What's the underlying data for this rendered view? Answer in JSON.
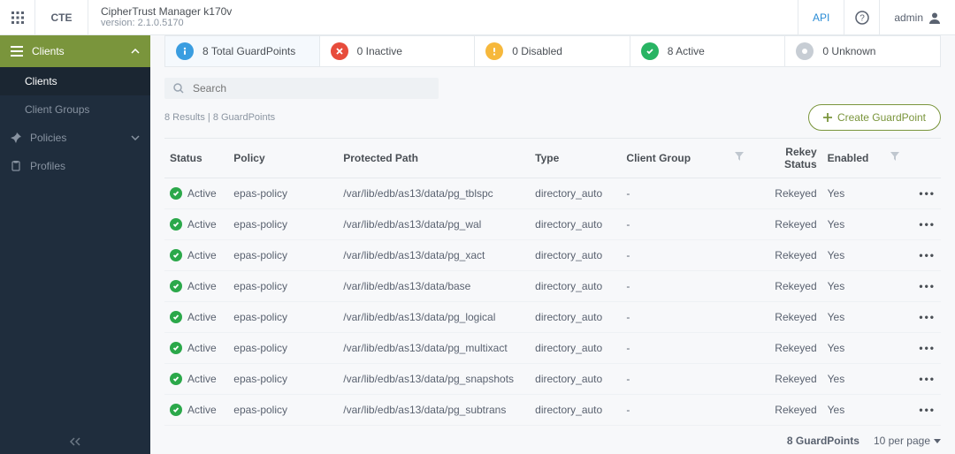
{
  "header": {
    "cte_label": "CTE",
    "product_name": "CipherTrust Manager k170v",
    "version_label": "version: 2.1.0.5170",
    "api_label": "API",
    "user_label": "admin"
  },
  "sidebar": {
    "section_label": "Clients",
    "items": [
      {
        "label": "Clients"
      },
      {
        "label": "Client Groups"
      }
    ],
    "top_items": [
      {
        "label": "Policies"
      },
      {
        "label": "Profiles"
      }
    ]
  },
  "summary": {
    "total": {
      "count": "8",
      "label": "Total GuardPoints"
    },
    "inactive": {
      "count": "0",
      "label": "Inactive"
    },
    "disabled": {
      "count": "0",
      "label": "Disabled"
    },
    "active": {
      "count": "8",
      "label": "Active"
    },
    "unknown": {
      "count": "0",
      "label": "Unknown"
    }
  },
  "search": {
    "placeholder": "Search"
  },
  "results_text": "8 Results | 8 GuardPoints",
  "create_button": "Create GuardPoint",
  "columns": {
    "status": "Status",
    "policy": "Policy",
    "path": "Protected Path",
    "type": "Type",
    "group": "Client Group",
    "rekey": "Rekey Status",
    "enabled": "Enabled"
  },
  "rows": [
    {
      "status": "Active",
      "policy": "epas-policy",
      "path": "/var/lib/edb/as13/data/pg_tblspc",
      "type": "directory_auto",
      "group": "-",
      "rekey": "Rekeyed",
      "enabled": "Yes"
    },
    {
      "status": "Active",
      "policy": "epas-policy",
      "path": "/var/lib/edb/as13/data/pg_wal",
      "type": "directory_auto",
      "group": "-",
      "rekey": "Rekeyed",
      "enabled": "Yes"
    },
    {
      "status": "Active",
      "policy": "epas-policy",
      "path": "/var/lib/edb/as13/data/pg_xact",
      "type": "directory_auto",
      "group": "-",
      "rekey": "Rekeyed",
      "enabled": "Yes"
    },
    {
      "status": "Active",
      "policy": "epas-policy",
      "path": "/var/lib/edb/as13/data/base",
      "type": "directory_auto",
      "group": "-",
      "rekey": "Rekeyed",
      "enabled": "Yes"
    },
    {
      "status": "Active",
      "policy": "epas-policy",
      "path": "/var/lib/edb/as13/data/pg_logical",
      "type": "directory_auto",
      "group": "-",
      "rekey": "Rekeyed",
      "enabled": "Yes"
    },
    {
      "status": "Active",
      "policy": "epas-policy",
      "path": "/var/lib/edb/as13/data/pg_multixact",
      "type": "directory_auto",
      "group": "-",
      "rekey": "Rekeyed",
      "enabled": "Yes"
    },
    {
      "status": "Active",
      "policy": "epas-policy",
      "path": "/var/lib/edb/as13/data/pg_snapshots",
      "type": "directory_auto",
      "group": "-",
      "rekey": "Rekeyed",
      "enabled": "Yes"
    },
    {
      "status": "Active",
      "policy": "epas-policy",
      "path": "/var/lib/edb/as13/data/pg_subtrans",
      "type": "directory_auto",
      "group": "-",
      "rekey": "Rekeyed",
      "enabled": "Yes"
    }
  ],
  "pager": {
    "total_label": "8 GuardPoints",
    "per_page_label": "10 per page"
  }
}
